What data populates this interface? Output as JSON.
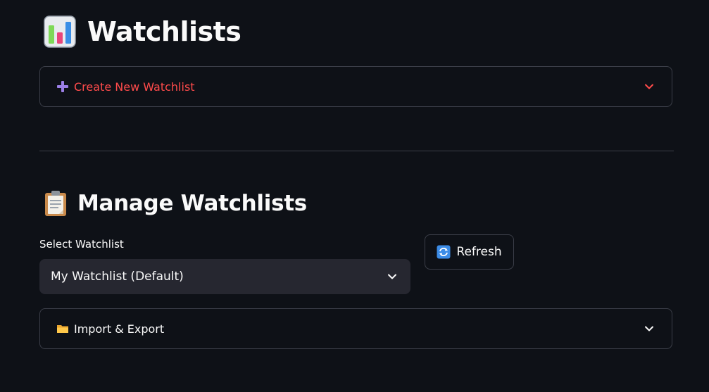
{
  "header": {
    "title": "Watchlists",
    "icon": "bar-chart-icon"
  },
  "create_expander": {
    "label": "Create New Watchlist",
    "icon": "plus-icon",
    "expanded": false,
    "label_color": "#ff4b4b"
  },
  "manage": {
    "title": "Manage Watchlists",
    "icon": "clipboard-icon",
    "select": {
      "label": "Select Watchlist",
      "value": "My Watchlist (Default)"
    },
    "refresh_button": {
      "label": "Refresh",
      "icon": "refresh-icon"
    }
  },
  "import_expander": {
    "label": "Import & Export",
    "icon": "folder-icon",
    "expanded": false
  },
  "theme": {
    "background": "#0e1117",
    "accent": "#ff4b4b",
    "border": "#3b3e48",
    "input_bg": "#262730"
  }
}
